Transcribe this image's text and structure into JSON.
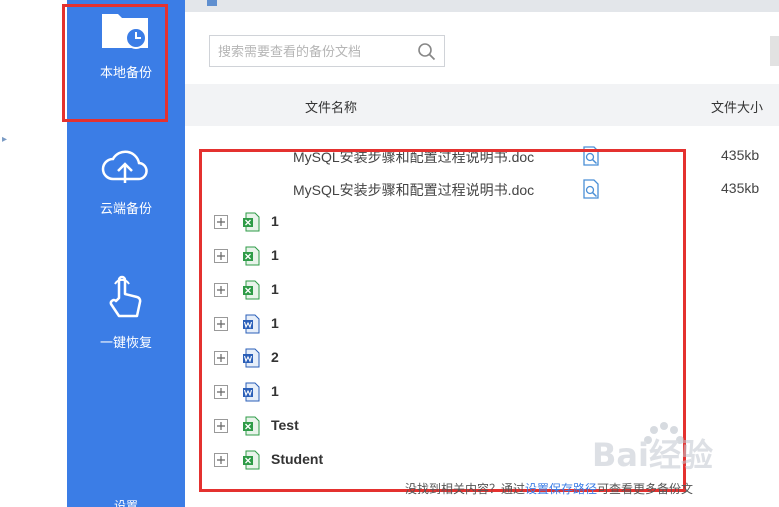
{
  "sidebar": {
    "items": [
      {
        "label": "本地备份",
        "icon": "folder-clock-icon"
      },
      {
        "label": "云端备份",
        "icon": "cloud-upload-icon"
      },
      {
        "label": "一键恢复",
        "icon": "hand-pointer-icon"
      },
      {
        "label": "设置",
        "icon": "gear-icon"
      }
    ],
    "active": "本地备份"
  },
  "search": {
    "placeholder": "搜索需要查看的备份文档"
  },
  "table": {
    "columns": [
      "文件名称",
      "文件大小"
    ],
    "files": [
      {
        "name": "MySQL安装步骤和配置过程说明书.doc",
        "size": "435kb"
      },
      {
        "name": "MySQL安装步骤和配置过程说明书.doc",
        "size": "435kb"
      }
    ],
    "folders": [
      {
        "name": "1",
        "type": "excel"
      },
      {
        "name": "1",
        "type": "excel"
      },
      {
        "name": "1",
        "type": "excel"
      },
      {
        "name": "1",
        "type": "word"
      },
      {
        "name": "2",
        "type": "word"
      },
      {
        "name": "1",
        "type": "word"
      },
      {
        "name": "Test",
        "type": "excel"
      },
      {
        "name": "Student",
        "type": "excel"
      }
    ]
  },
  "footer": {
    "hint_prefix": "没找到相关内容？通过",
    "hint_link": "设置保存路径",
    "hint_suffix": "可查看更多备份文"
  },
  "watermark": {
    "text": "Bai经验"
  },
  "colors": {
    "sidebar": "#3b7de6",
    "highlight": "#e4312f",
    "excel": "#2e9b47",
    "word": "#2b5fb8"
  }
}
